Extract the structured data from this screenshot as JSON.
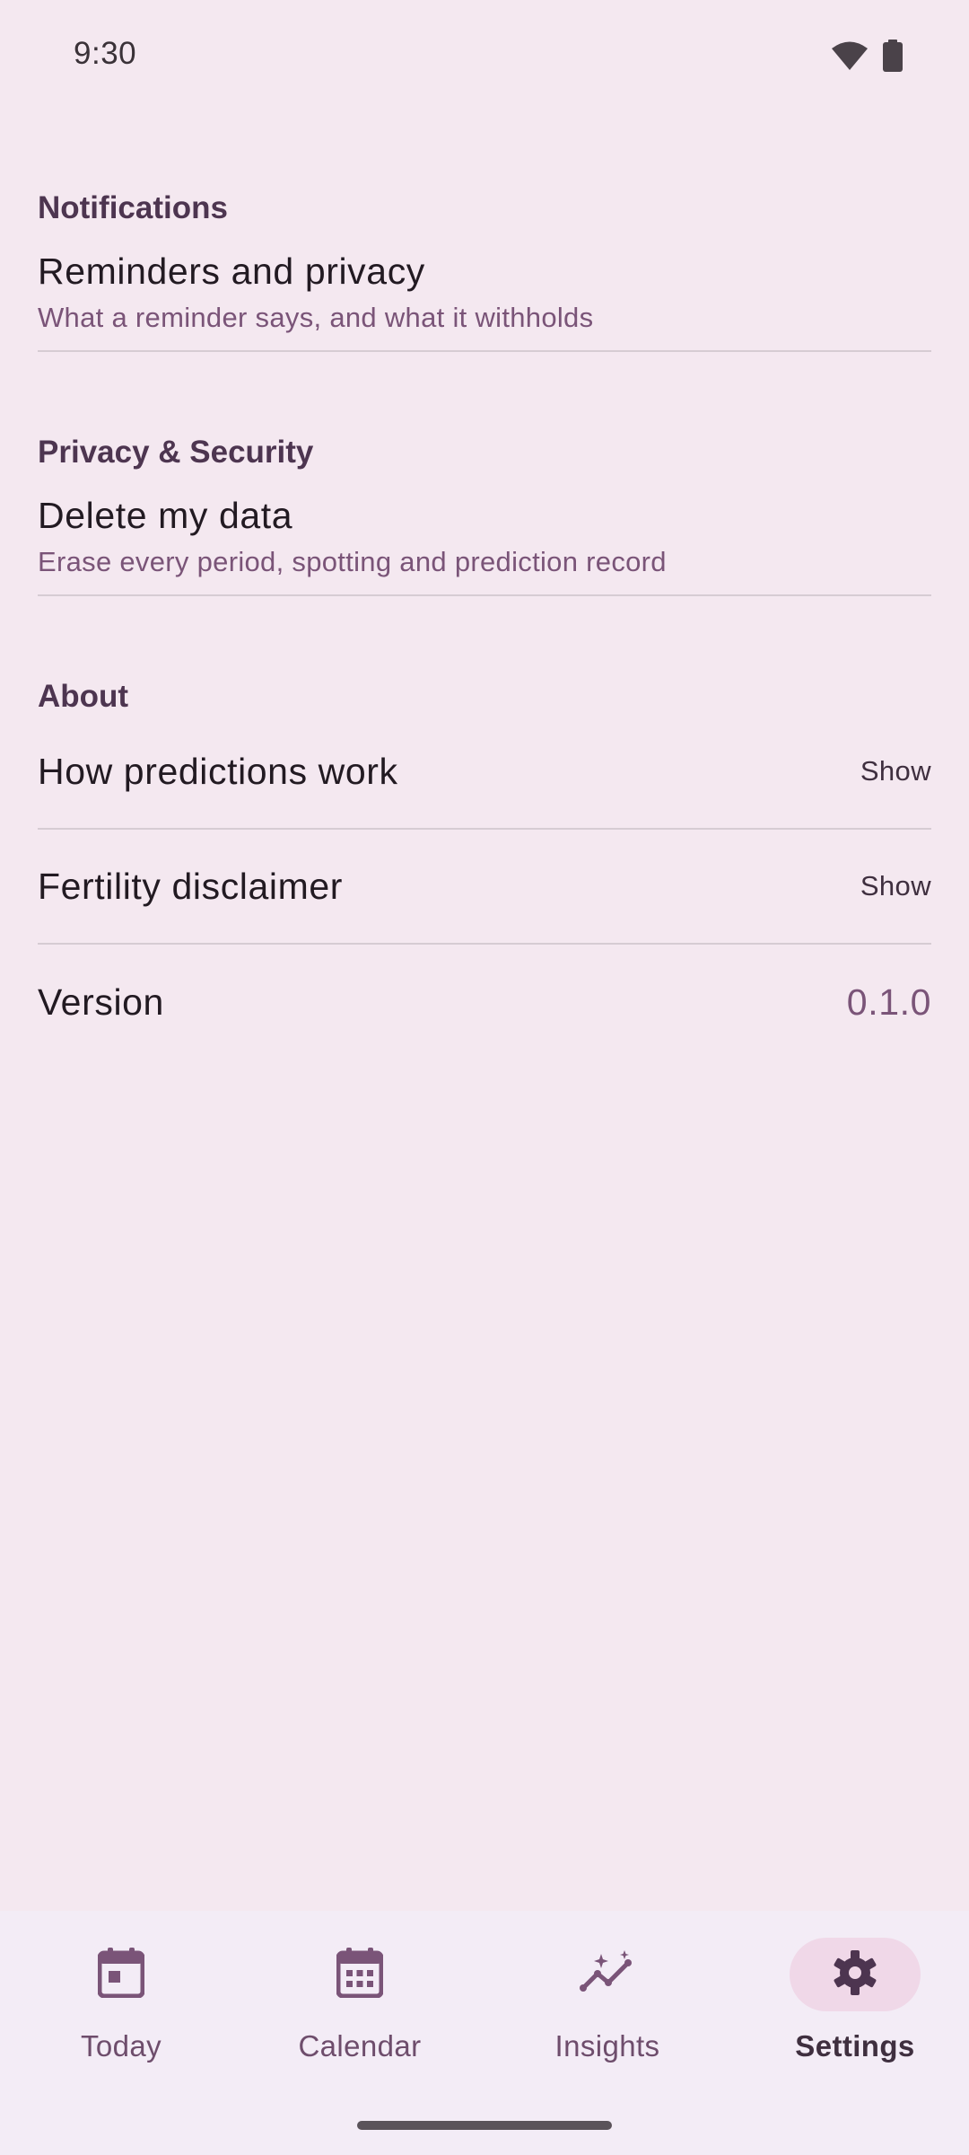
{
  "status_bar": {
    "time": "9:30",
    "icons": [
      "wifi-icon",
      "battery-icon"
    ]
  },
  "sections": {
    "notifications": {
      "header": "Notifications",
      "reminders": {
        "title": "Reminders and privacy",
        "subtitle": "What a reminder says, and what it withholds"
      }
    },
    "privacy": {
      "header": "Privacy & Security",
      "delete": {
        "title": "Delete my data",
        "subtitle": "Erase every period, spotting and prediction record"
      }
    },
    "about": {
      "header": "About",
      "predictions": {
        "title": "How predictions work",
        "action": "Show"
      },
      "disclaimer": {
        "title": "Fertility disclaimer",
        "action": "Show"
      },
      "version": {
        "title": "Version",
        "value": "0.1.0"
      }
    }
  },
  "bottom_nav": {
    "items": [
      {
        "label": "Today",
        "icon": "calendar-today-icon",
        "active": false
      },
      {
        "label": "Calendar",
        "icon": "calendar-month-icon",
        "active": false
      },
      {
        "label": "Insights",
        "icon": "insights-icon",
        "active": false
      },
      {
        "label": "Settings",
        "icon": "gear-icon",
        "active": true
      }
    ]
  },
  "colors": {
    "background": "#f4e8f0",
    "accent": "#7a5478",
    "section_header": "#4d3550",
    "nav_active_pill": "#f0d8e8"
  }
}
